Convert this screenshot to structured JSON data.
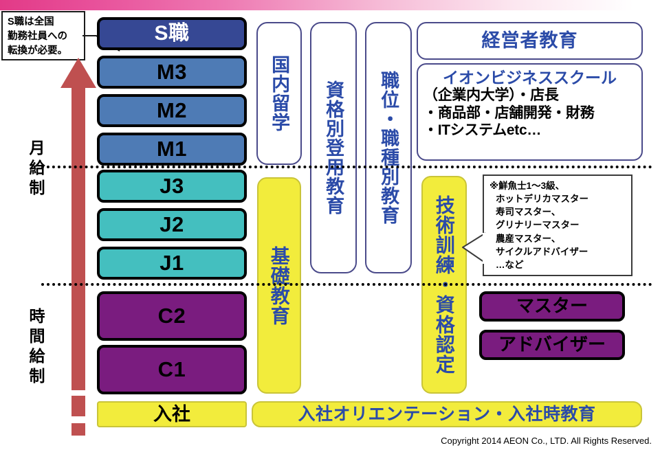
{
  "meta": {
    "title": "AEON Career Path and Education System",
    "copyright": "Copyright 2014 AEON Co., LTD. All Rights Reserved."
  },
  "colors": {
    "pink_accent": "#e23a87",
    "grade_s": "#364894",
    "grade_m": "#4e7bb5",
    "grade_j": "#44bfbf",
    "grade_c": "#7a1c7f",
    "yellow": "#f2ec3c",
    "program_text_blue": "#2b4ba8",
    "arrow_red": "#bf5050",
    "outline_black": "#000000"
  },
  "callout": {
    "name": "s-grade-note",
    "lines": [
      "S職は全国",
      "勤務社員への",
      "転換が必要。"
    ]
  },
  "pay_systems": [
    {
      "label": "月給制"
    },
    {
      "label": "時間給制"
    }
  ],
  "grades": [
    {
      "id": "s",
      "label": "S職",
      "tier": "s"
    },
    {
      "id": "m3",
      "label": "M3",
      "tier": "m"
    },
    {
      "id": "m2",
      "label": "M2",
      "tier": "m"
    },
    {
      "id": "m1",
      "label": "M1",
      "tier": "m"
    },
    {
      "id": "j3",
      "label": "J3",
      "tier": "j"
    },
    {
      "id": "j2",
      "label": "J2",
      "tier": "j"
    },
    {
      "id": "j1",
      "label": "J1",
      "tier": "j"
    },
    {
      "id": "c2",
      "label": "C2",
      "tier": "c"
    },
    {
      "id": "c1",
      "label": "C1",
      "tier": "c"
    },
    {
      "id": "entry",
      "label": "入社",
      "tier": "entry"
    }
  ],
  "programs": {
    "domestic_study": "国内留学",
    "qualification_promotion": "資格別登用教育",
    "position_jobtype": "職位・職種別教育",
    "basic_education": "基礎教育",
    "technical_training": "技術訓練・資格認定"
  },
  "executive": {
    "exec_education": "経営者教育",
    "business_school": {
      "title": "イオンビジネススクール",
      "lines": [
        "（企業内大学）・店長",
        "・商品部・店舗開発・財務",
        "・ITシステムetc…"
      ]
    }
  },
  "cert_note": {
    "lines": [
      "※鮮魚士1～3級、",
      "ホットデリカマスター",
      "寿司マスター、",
      "グリナリーマスター",
      "農産マスター、",
      "サイクルアドバイザー",
      "…など"
    ]
  },
  "certifications": [
    {
      "label": "マスター"
    },
    {
      "label": "アドバイザー"
    }
  ],
  "orientation": {
    "label": "入社オリエンテーション・入社時教育"
  }
}
